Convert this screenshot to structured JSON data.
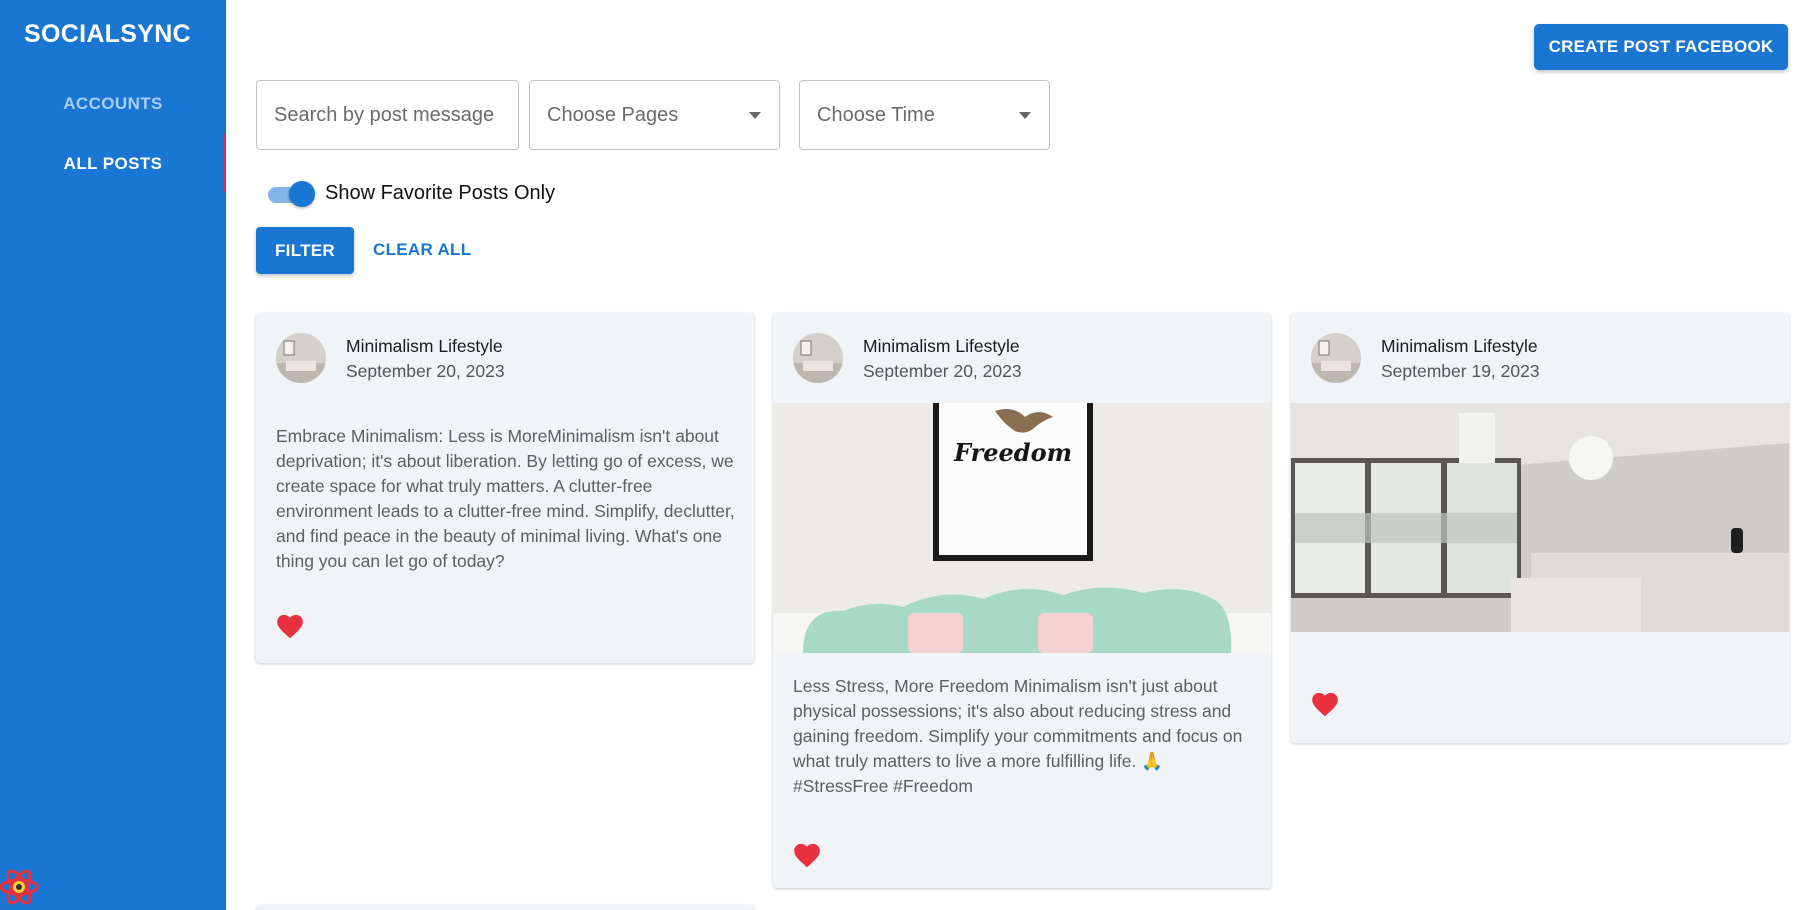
{
  "sidebar": {
    "brand": "SOCIALSYNC",
    "items": [
      {
        "label": "ACCOUNTS"
      },
      {
        "label": "ALL POSTS"
      }
    ]
  },
  "header": {
    "create_button": "CREATE POST FACEBOOK"
  },
  "filters": {
    "search_placeholder": "Search by post message",
    "pages_select": "Choose Pages",
    "time_select": "Choose Time",
    "favorite_toggle_label": "Show Favorite Posts Only",
    "favorite_toggle_on": true,
    "filter_button": "FILTER",
    "clear_button": "CLEAR ALL"
  },
  "posts": [
    {
      "page": "Minimalism Lifestyle",
      "date": "September 20, 2023",
      "message": "Embrace Minimalism: Less is MoreMinimalism isn't about deprivation; it's about liberation. By letting go of excess, we create space for what truly matters. A clutter-free environment leads to a clutter-free mind. Simplify, declutter, and find peace in the beauty of minimal living. What's one thing you can let go of today?",
      "favorite": true
    },
    {
      "page": "Minimalism Lifestyle",
      "date": "September 20, 2023",
      "image_text": "Freedom",
      "message": "Less Stress, More Freedom Minimalism isn't just about physical possessions; it's also about reducing stress and gaining freedom. Simplify your commitments and focus on what truly matters to live a more fulfilling life. 🙏 #StressFree #Freedom",
      "favorite": true
    },
    {
      "page": "Minimalism Lifestyle",
      "date": "September 19, 2023",
      "favorite": true
    }
  ],
  "colors": {
    "primary": "#1976d2",
    "card_bg": "#f1f4f7",
    "heart": "#e8303f",
    "active_indicator": "#e91e63"
  },
  "icons": [
    "heart-icon",
    "chevron-down-icon",
    "react-logo-icon"
  ]
}
